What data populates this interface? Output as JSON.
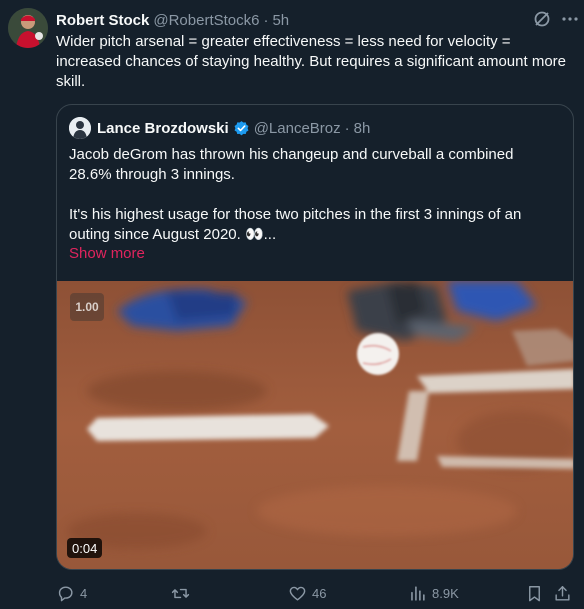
{
  "tweet": {
    "author_name": "Robert Stock",
    "author_handle": "@RobertStock6",
    "separator": "·",
    "time": "5h",
    "text": "Wider pitch arsenal = greater effectiveness = less need for velocity = increased chances of staying healthy. But requires a significant amount more skill."
  },
  "quote": {
    "author_name": "Lance Brozdowski",
    "author_handle": "@LanceBroz",
    "separator": "·",
    "time": "8h",
    "line1": "Jacob deGrom has thrown his changeup and curveball a combined 28.6% through 3 innings.",
    "line2": "It's his highest usage for those two pitches in the first 3 innings of an outing since August 2020. 👀...",
    "show_more": "Show more",
    "video": {
      "speed": "1.00",
      "duration": "0:04"
    }
  },
  "actions": {
    "replies": "4",
    "retweets": "",
    "likes": "46",
    "views": "8.9K"
  },
  "colors": {
    "background": "#15202b",
    "muted": "#8b98a5",
    "show_more": "#e0245e",
    "verified": "#1d9bf0"
  },
  "icons": [
    "grok-icon",
    "more-icon",
    "verified-badge-icon",
    "reply-icon",
    "retweet-icon",
    "like-icon",
    "views-icon",
    "bookmark-icon",
    "share-icon"
  ]
}
